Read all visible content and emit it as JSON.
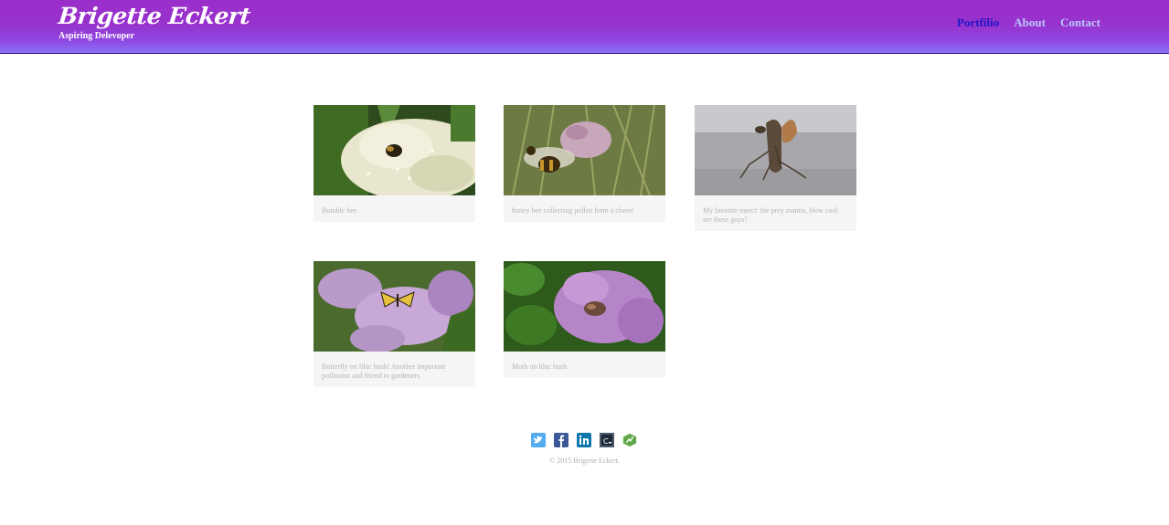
{
  "header": {
    "site_name": "Brigette Eckert",
    "tagline": "Aspiring Delevoper",
    "background_color": "#9932cc",
    "nav": [
      {
        "label": "Portfilio",
        "active": true
      },
      {
        "label": "About",
        "active": false
      },
      {
        "label": "Contact",
        "active": false
      }
    ]
  },
  "gallery": [
    {
      "caption": "Bumble bee.",
      "image": "bumble-bee-on-white-flowers"
    },
    {
      "caption": "honey bee collecting pollen from a clover",
      "image": "honey-bee-on-clover"
    },
    {
      "caption": "My favorite insect: the prey mantis. How cool are these guys?",
      "image": "praying-mantis"
    },
    {
      "caption": "Butterfly on lilac bush! Another important pollinator and friend to gardeners",
      "image": "butterfly-on-lilac"
    },
    {
      "caption": "Moth on lilac bush",
      "image": "moth-on-lilac"
    }
  ],
  "footer": {
    "social": [
      {
        "name": "twitter-icon",
        "glyph": "t",
        "color": "#55acee"
      },
      {
        "name": "facebook-icon",
        "glyph": "f",
        "color": "#3b5998"
      },
      {
        "name": "linkedin-icon",
        "glyph": "in",
        "color": "#0e76a8"
      },
      {
        "name": "codepen-icon",
        "glyph": "C",
        "color": "#1e2a3a"
      },
      {
        "name": "treehouse-icon",
        "glyph": "✓",
        "color": "#5fcf80"
      }
    ],
    "copyright": "© 2015 Brigette Eckert."
  }
}
